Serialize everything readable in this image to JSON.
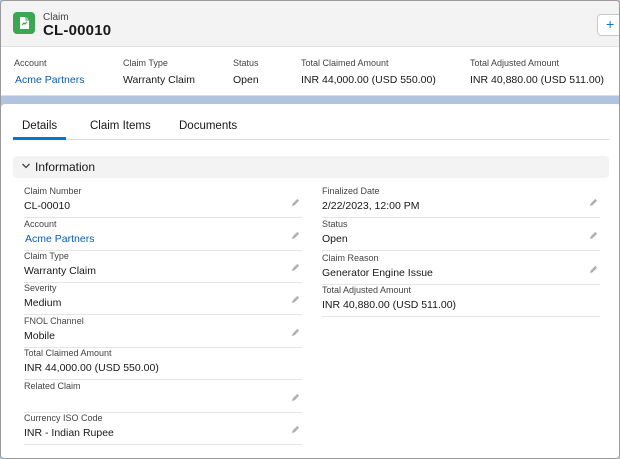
{
  "header": {
    "object_label": "Claim",
    "record_name": "CL-00010",
    "add_button": "+",
    "highlights": [
      {
        "label": "Account",
        "value": "Acme Partners",
        "link": true
      },
      {
        "label": "Claim Type",
        "value": "Warranty Claim"
      },
      {
        "label": "Status",
        "value": "Open"
      },
      {
        "label": "Total Claimed Amount",
        "value": "INR 44,000.00 (USD 550.00)"
      },
      {
        "label": "Total Adjusted Amount",
        "value": "INR 40,880.00 (USD 511.00)"
      }
    ]
  },
  "tabs": [
    {
      "label": "Details",
      "active": true
    },
    {
      "label": "Claim Items"
    },
    {
      "label": "Documents"
    }
  ],
  "section": {
    "title": "Information",
    "icon": "chevron-down-icon"
  },
  "left_fields": [
    {
      "label": "Claim Number",
      "value": "CL-00010"
    },
    {
      "label": "Account",
      "value": "Acme Partners",
      "link": true
    },
    {
      "label": "Claim Type",
      "value": "Warranty Claim"
    },
    {
      "label": "Severity",
      "value": "Medium"
    },
    {
      "label": "FNOL Channel",
      "value": "Mobile"
    },
    {
      "label": "Total Claimed Amount",
      "value": "INR 44,000.00 (USD 550.00)"
    },
    {
      "label": "Related Claim",
      "value": ""
    },
    {
      "label": "Currency ISO Code",
      "value": "INR - Indian Rupee"
    }
  ],
  "right_fields": [
    {
      "label": "Finalized Date",
      "value": "2/22/2023, 12:00 PM"
    },
    {
      "label": "Status",
      "value": "Open"
    },
    {
      "label": "Claim Reason",
      "value": "Generator Engine Issue"
    },
    {
      "label": "Total Adjusted Amount",
      "value": "INR 40,880.00 (USD 511.00)"
    }
  ],
  "colors": {
    "accent": "#0176d3",
    "link": "#0b5cab",
    "object_icon": "#3ba755",
    "backdrop": "#b0c4df"
  }
}
